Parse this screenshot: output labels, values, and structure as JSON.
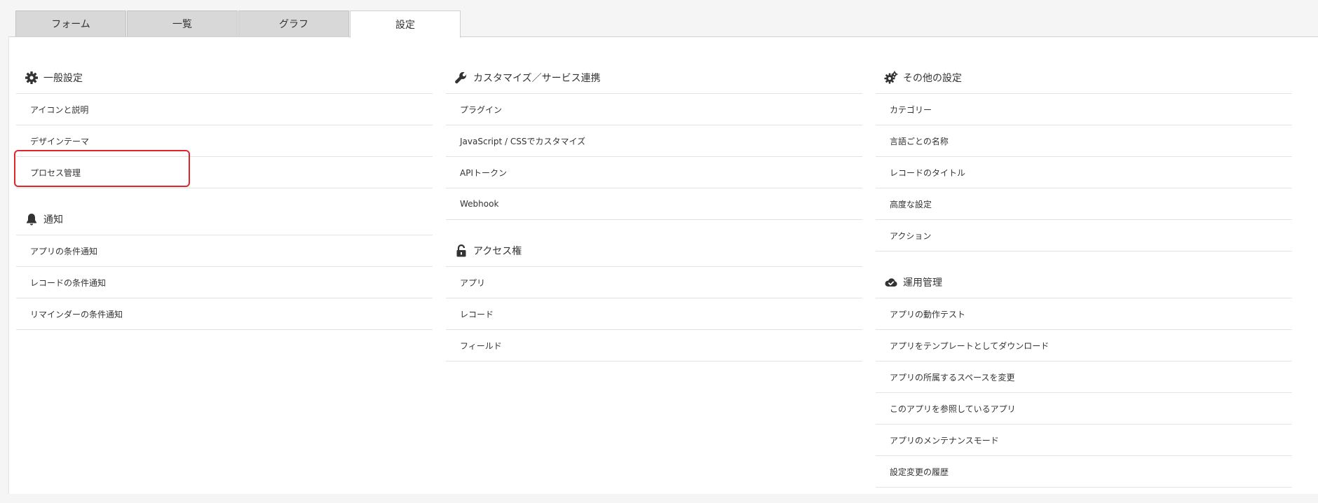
{
  "tabs": [
    {
      "label": "フォーム"
    },
    {
      "label": "一覧"
    },
    {
      "label": "グラフ"
    },
    {
      "label": "設定"
    }
  ],
  "columns": [
    {
      "sections": [
        {
          "title": "一般設定",
          "icon": "gear-icon",
          "items": [
            "アイコンと説明",
            "デザインテーマ",
            "プロセス管理"
          ]
        },
        {
          "title": "通知",
          "icon": "bell-icon",
          "items": [
            "アプリの条件通知",
            "レコードの条件通知",
            "リマインダーの条件通知"
          ]
        }
      ]
    },
    {
      "sections": [
        {
          "title": "カスタマイズ／サービス連携",
          "icon": "wrench-icon",
          "items": [
            "プラグイン",
            "JavaScript / CSSでカスタマイズ",
            "APIトークン",
            "Webhook"
          ]
        },
        {
          "title": "アクセス権",
          "icon": "unlock-icon",
          "items": [
            "アプリ",
            "レコード",
            "フィールド"
          ]
        }
      ]
    },
    {
      "sections": [
        {
          "title": "その他の設定",
          "icon": "gears-icon",
          "items": [
            "カテゴリー",
            "言語ごとの名称",
            "レコードのタイトル",
            "高度な設定",
            "アクション"
          ]
        },
        {
          "title": "運用管理",
          "icon": "cloud-check-icon",
          "items": [
            "アプリの動作テスト",
            "アプリをテンプレートとしてダウンロード",
            "アプリの所属するスペースを変更",
            "このアプリを参照しているアプリ",
            "アプリのメンテナンスモード",
            "設定変更の履歴"
          ]
        }
      ]
    }
  ],
  "colors": {
    "highlight": "#e0262c",
    "text": "#333333",
    "divider": "#e3e3e3"
  }
}
